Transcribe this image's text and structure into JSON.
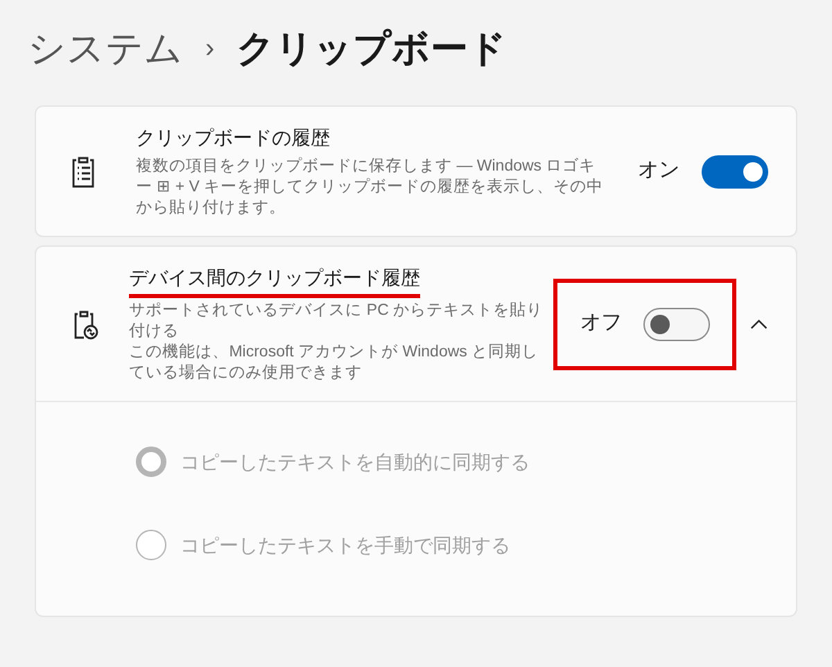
{
  "breadcrumb": [
    {
      "label": "システム"
    },
    {
      "label": "›"
    },
    {
      "label": "クリップボード"
    }
  ],
  "settings": [
    {
      "title": "クリップボードの履歴",
      "title_highlighted": false,
      "descriptions": [
        "複数の項目をクリップボードに保存します ― Windows ロゴキー ⊞ + V キーを押してクリップボードの履歴を表示し、その中から貼り付けます。"
      ],
      "state_label": "オン",
      "on": true,
      "toggle_highlighted": false
    },
    {
      "title": "デバイス間のクリップボード履歴",
      "title_highlighted": true,
      "descriptions": [
        "サポートされているデバイスに PC からテキストを貼り付ける",
        "この機能は、Microsoft アカウントが Windows と同期している場合にのみ使用できます"
      ],
      "state_label": "オフ",
      "on": false,
      "toggle_highlighted": true,
      "expanded": true,
      "options": [
        {
          "label": "コピーしたテキストを自動的に同期する",
          "selected": true,
          "disabled": true
        },
        {
          "label": "コピーしたテキストを手動で同期する",
          "selected": false,
          "disabled": true
        }
      ]
    }
  ]
}
